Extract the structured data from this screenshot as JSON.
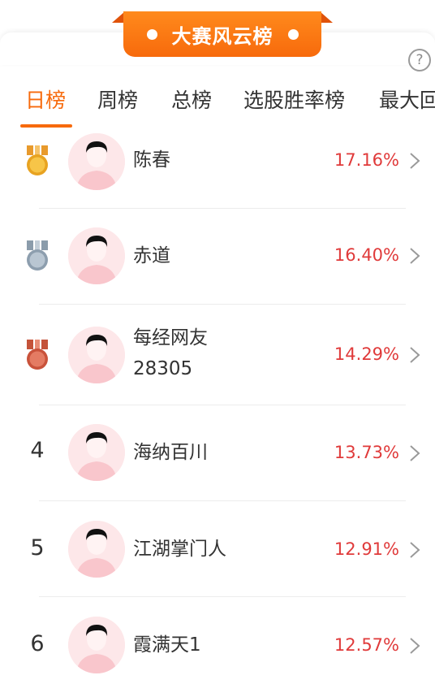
{
  "banner": {
    "title": "大赛风云榜"
  },
  "help": {
    "glyph": "?"
  },
  "tabs": [
    {
      "label": "日榜",
      "active": true
    },
    {
      "label": "周榜",
      "active": false
    },
    {
      "label": "总榜",
      "active": false
    },
    {
      "label": "选股胜率榜",
      "active": false
    },
    {
      "label": "最大回",
      "active": false
    }
  ],
  "colors": {
    "accent": "#f76a0c",
    "rate": "#e03a3a"
  },
  "rows": [
    {
      "rank": "1",
      "medal": "gold",
      "name": "陈春",
      "rate": "17.16%"
    },
    {
      "rank": "2",
      "medal": "silver",
      "name": "赤道",
      "rate": "16.40%"
    },
    {
      "rank": "3",
      "medal": "bronze",
      "name": "每经网友",
      "name2": "28305",
      "rate": "14.29%"
    },
    {
      "rank": "4",
      "name": "海纳百川",
      "rate": "13.73%"
    },
    {
      "rank": "5",
      "name": "江湖掌门人",
      "rate": "12.91%"
    },
    {
      "rank": "6",
      "name": "霞满天1",
      "rate": "12.57%"
    }
  ]
}
